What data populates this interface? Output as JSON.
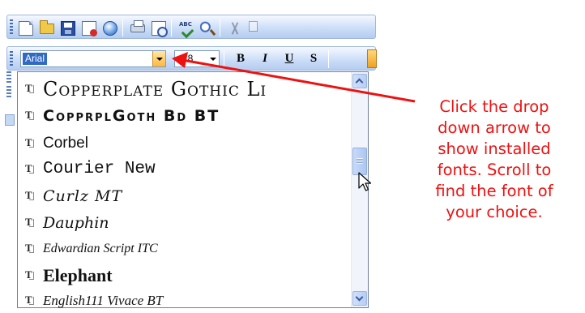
{
  "toolbar_standard": {
    "buttons": [
      "new-icon",
      "open-icon",
      "save-icon",
      "permission-icon",
      "email-icon",
      "print-icon",
      "print-preview-icon",
      "spelling-icon",
      "research-icon",
      "cut-icon",
      "copy-icon"
    ]
  },
  "toolbar_formatting": {
    "font_name": "Arial",
    "font_size": "18",
    "bold_label": "B",
    "italic_label": "I",
    "underline_label": "U",
    "shadow_label": "S"
  },
  "font_list": {
    "items": [
      {
        "name": "Copperplate Gothic Li",
        "style": "f-copper"
      },
      {
        "name": "CopprplGoth Bd BT",
        "style": "f-copperbd"
      },
      {
        "name": "Corbel",
        "style": "f-corbel"
      },
      {
        "name": "Courier New",
        "style": "f-courier"
      },
      {
        "name": "Curlz MT",
        "style": "f-curlz"
      },
      {
        "name": "Dauphin",
        "style": "f-dauphin"
      },
      {
        "name": "Edwardian Script ITC",
        "style": "f-edward"
      },
      {
        "name": "Elephant",
        "style": "f-elephant"
      },
      {
        "name": "English111 Vivace BT",
        "style": "f-english"
      }
    ],
    "type_icon": "truetype-icon"
  },
  "callout": {
    "lines": [
      "Click the drop",
      "down arrow to",
      "show installed",
      "fonts.  Scroll to",
      "find the font of",
      "your choice."
    ],
    "color": "#ee1111"
  },
  "colors": {
    "toolbar": "#c9dcf7",
    "selection": "#316ac5",
    "dropdown_arrow": "#ffb640"
  }
}
